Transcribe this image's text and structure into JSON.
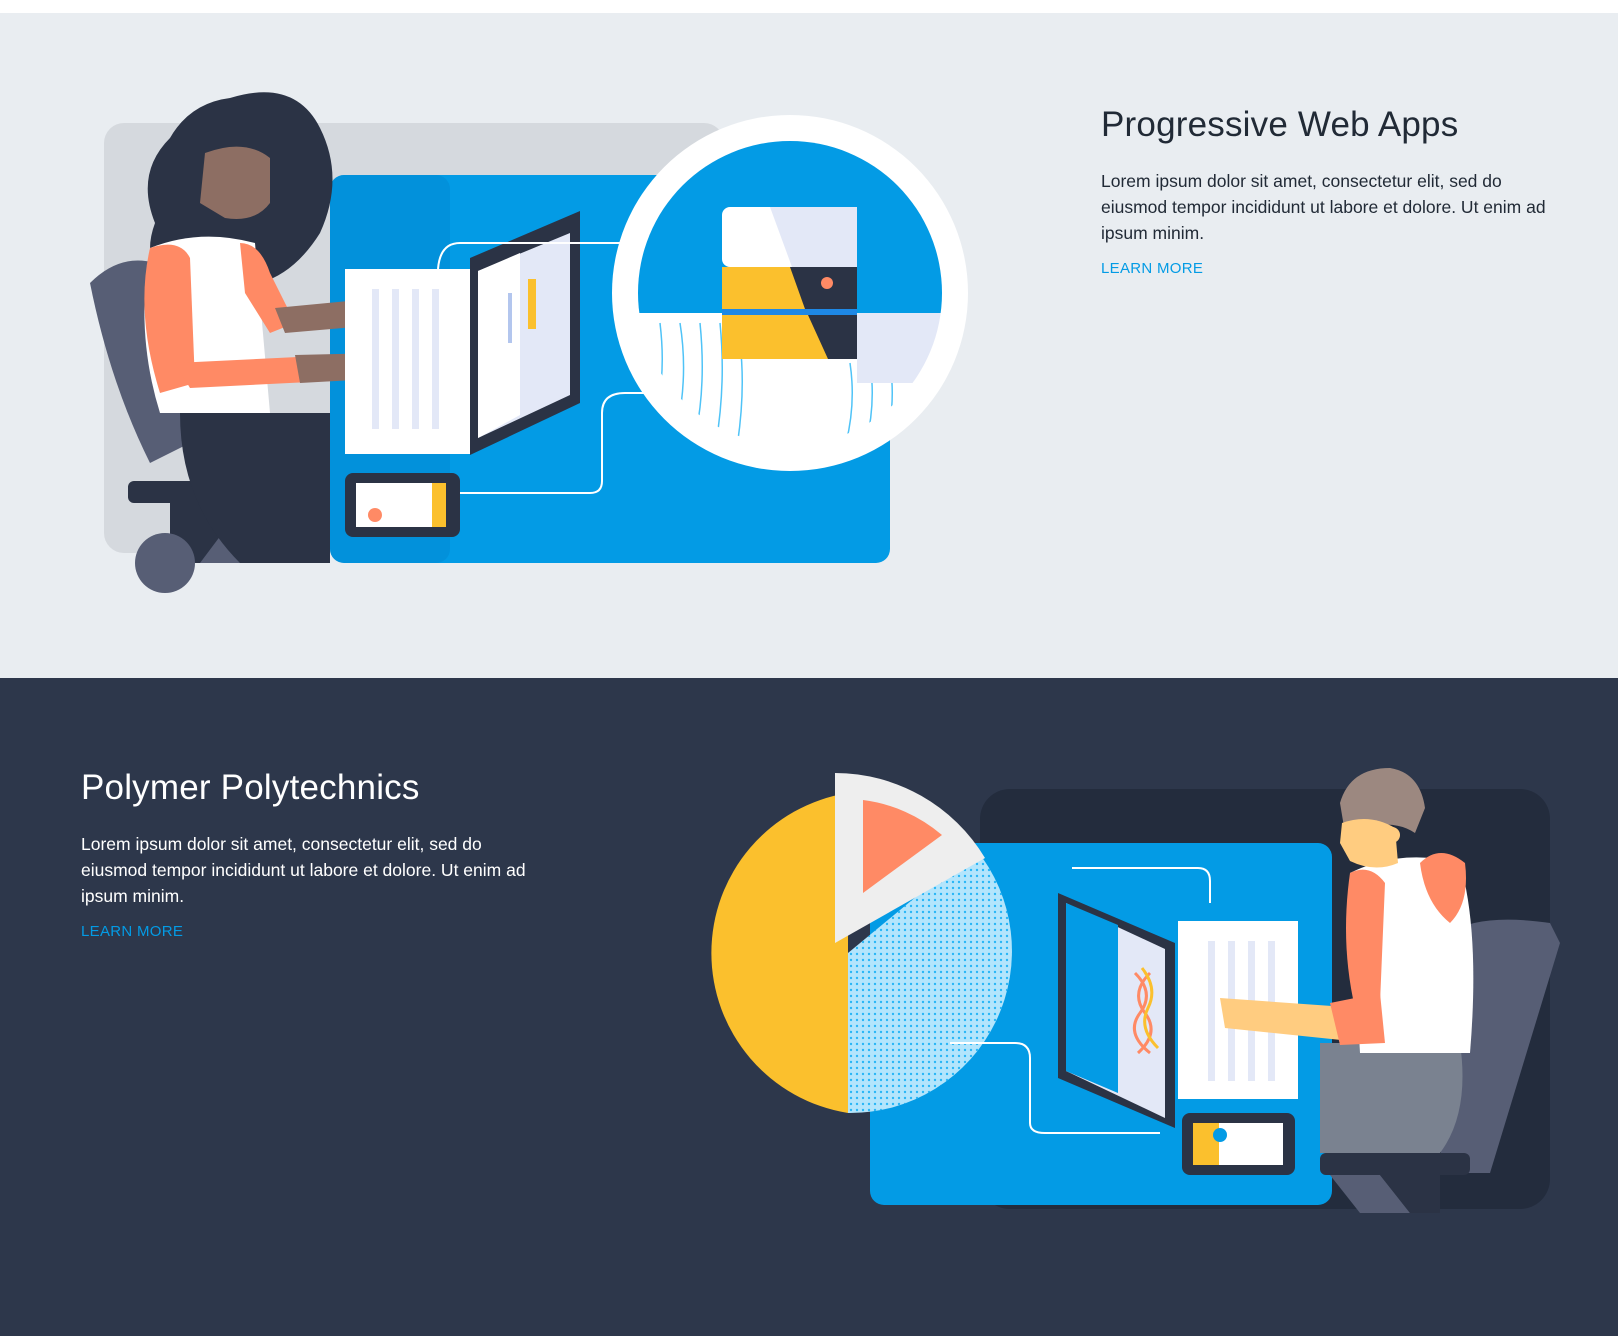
{
  "sections": [
    {
      "title": "Progressive Web Apps",
      "body": "Lorem ipsum dolor sit amet, consectetur elit, sed do eiusmod tempor incididunt ut labore et dolore. Ut enim ad ipsum minim.",
      "link_label": "LEARN MORE",
      "illustration": "person-at-computer-with-server-illustration",
      "background": "#e9edf1"
    },
    {
      "title": "Polymer Polytechnics",
      "body": "Lorem ipsum dolor sit amet, consectetur elit, sed do eiusmod tempor incididunt ut labore et dolore. Ut enim ad ipsum minim.",
      "link_label": "LEARN MORE",
      "illustration": "person-at-computer-with-pie-chart-illustration",
      "background": "#2d374b"
    }
  ],
  "colors": {
    "accent": "#039be5",
    "blue": "#0b9be4",
    "yellow": "#fbc02d",
    "coral": "#ff8a65",
    "navy": "#2b3345"
  }
}
